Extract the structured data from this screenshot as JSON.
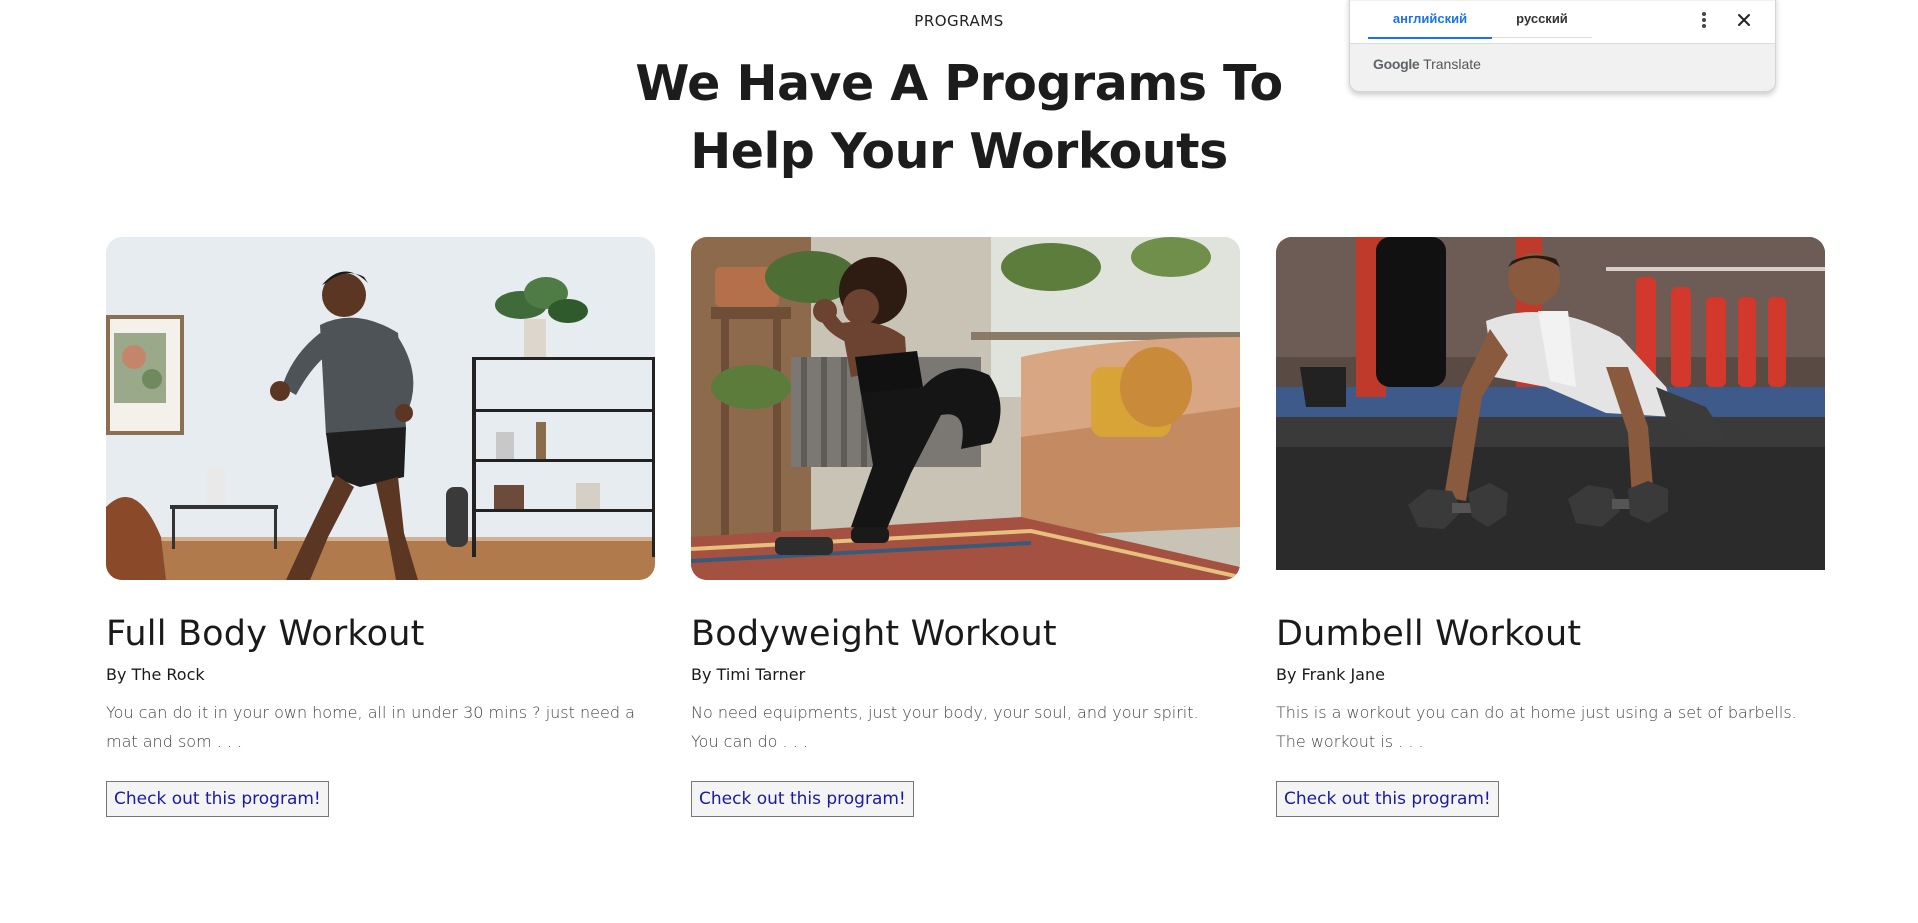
{
  "section": {
    "eyebrow": "PROGRAMS",
    "headline": "We Have A Programs To Help Your Workouts"
  },
  "programs": [
    {
      "title": "Full Body Workout",
      "author": "By The Rock",
      "description": "You can do it in your own home, all in under 30 mins ? just need a mat and som . . .",
      "button": "Check out this program!"
    },
    {
      "title": "Bodyweight Workout",
      "author": "By Timi Tarner",
      "description": "No need equipments, just your body, your soul, and your spirit. You can do . . .",
      "button": "Check out this program!"
    },
    {
      "title": "Dumbell Workout",
      "author": "By Frank Jane",
      "description": "This is a workout you can do at home just using a set of barbells. The workout is . . .",
      "button": "Check out this program!"
    }
  ],
  "translate_popup": {
    "tab_source": "английский",
    "tab_target": "русский",
    "brand_google": "Google",
    "brand_translate": "Translate",
    "more_icon": "more-vert-icon",
    "close_icon": "close-icon",
    "accent_color": "#1a73e8"
  }
}
